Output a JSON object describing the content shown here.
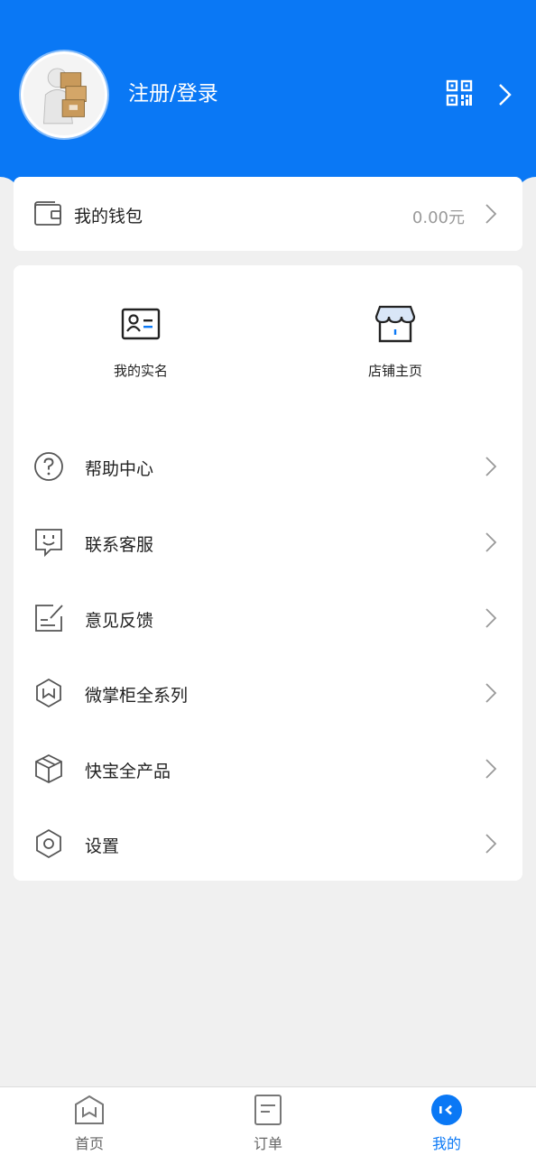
{
  "header": {
    "login_label": "注册/登录",
    "brand_color": "#0a78f5"
  },
  "wallet": {
    "label": "我的钱包",
    "amount": "0.00元"
  },
  "quick_links": [
    {
      "label": "我的实名",
      "icon": "id-card-icon"
    },
    {
      "label": "店铺主页",
      "icon": "store-icon"
    }
  ],
  "menu": [
    {
      "label": "帮助中心",
      "icon": "help-icon"
    },
    {
      "label": "联系客服",
      "icon": "customer-service-icon"
    },
    {
      "label": "意见反馈",
      "icon": "feedback-icon"
    },
    {
      "label": "微掌柜全系列",
      "icon": "hexagon-w-icon"
    },
    {
      "label": "快宝全产品",
      "icon": "box-icon"
    },
    {
      "label": "设置",
      "icon": "settings-icon"
    }
  ],
  "tabbar": [
    {
      "label": "首页",
      "icon": "home-icon",
      "active": false
    },
    {
      "label": "订单",
      "icon": "order-icon",
      "active": false
    },
    {
      "label": "我的",
      "icon": "profile-icon",
      "active": true
    }
  ]
}
